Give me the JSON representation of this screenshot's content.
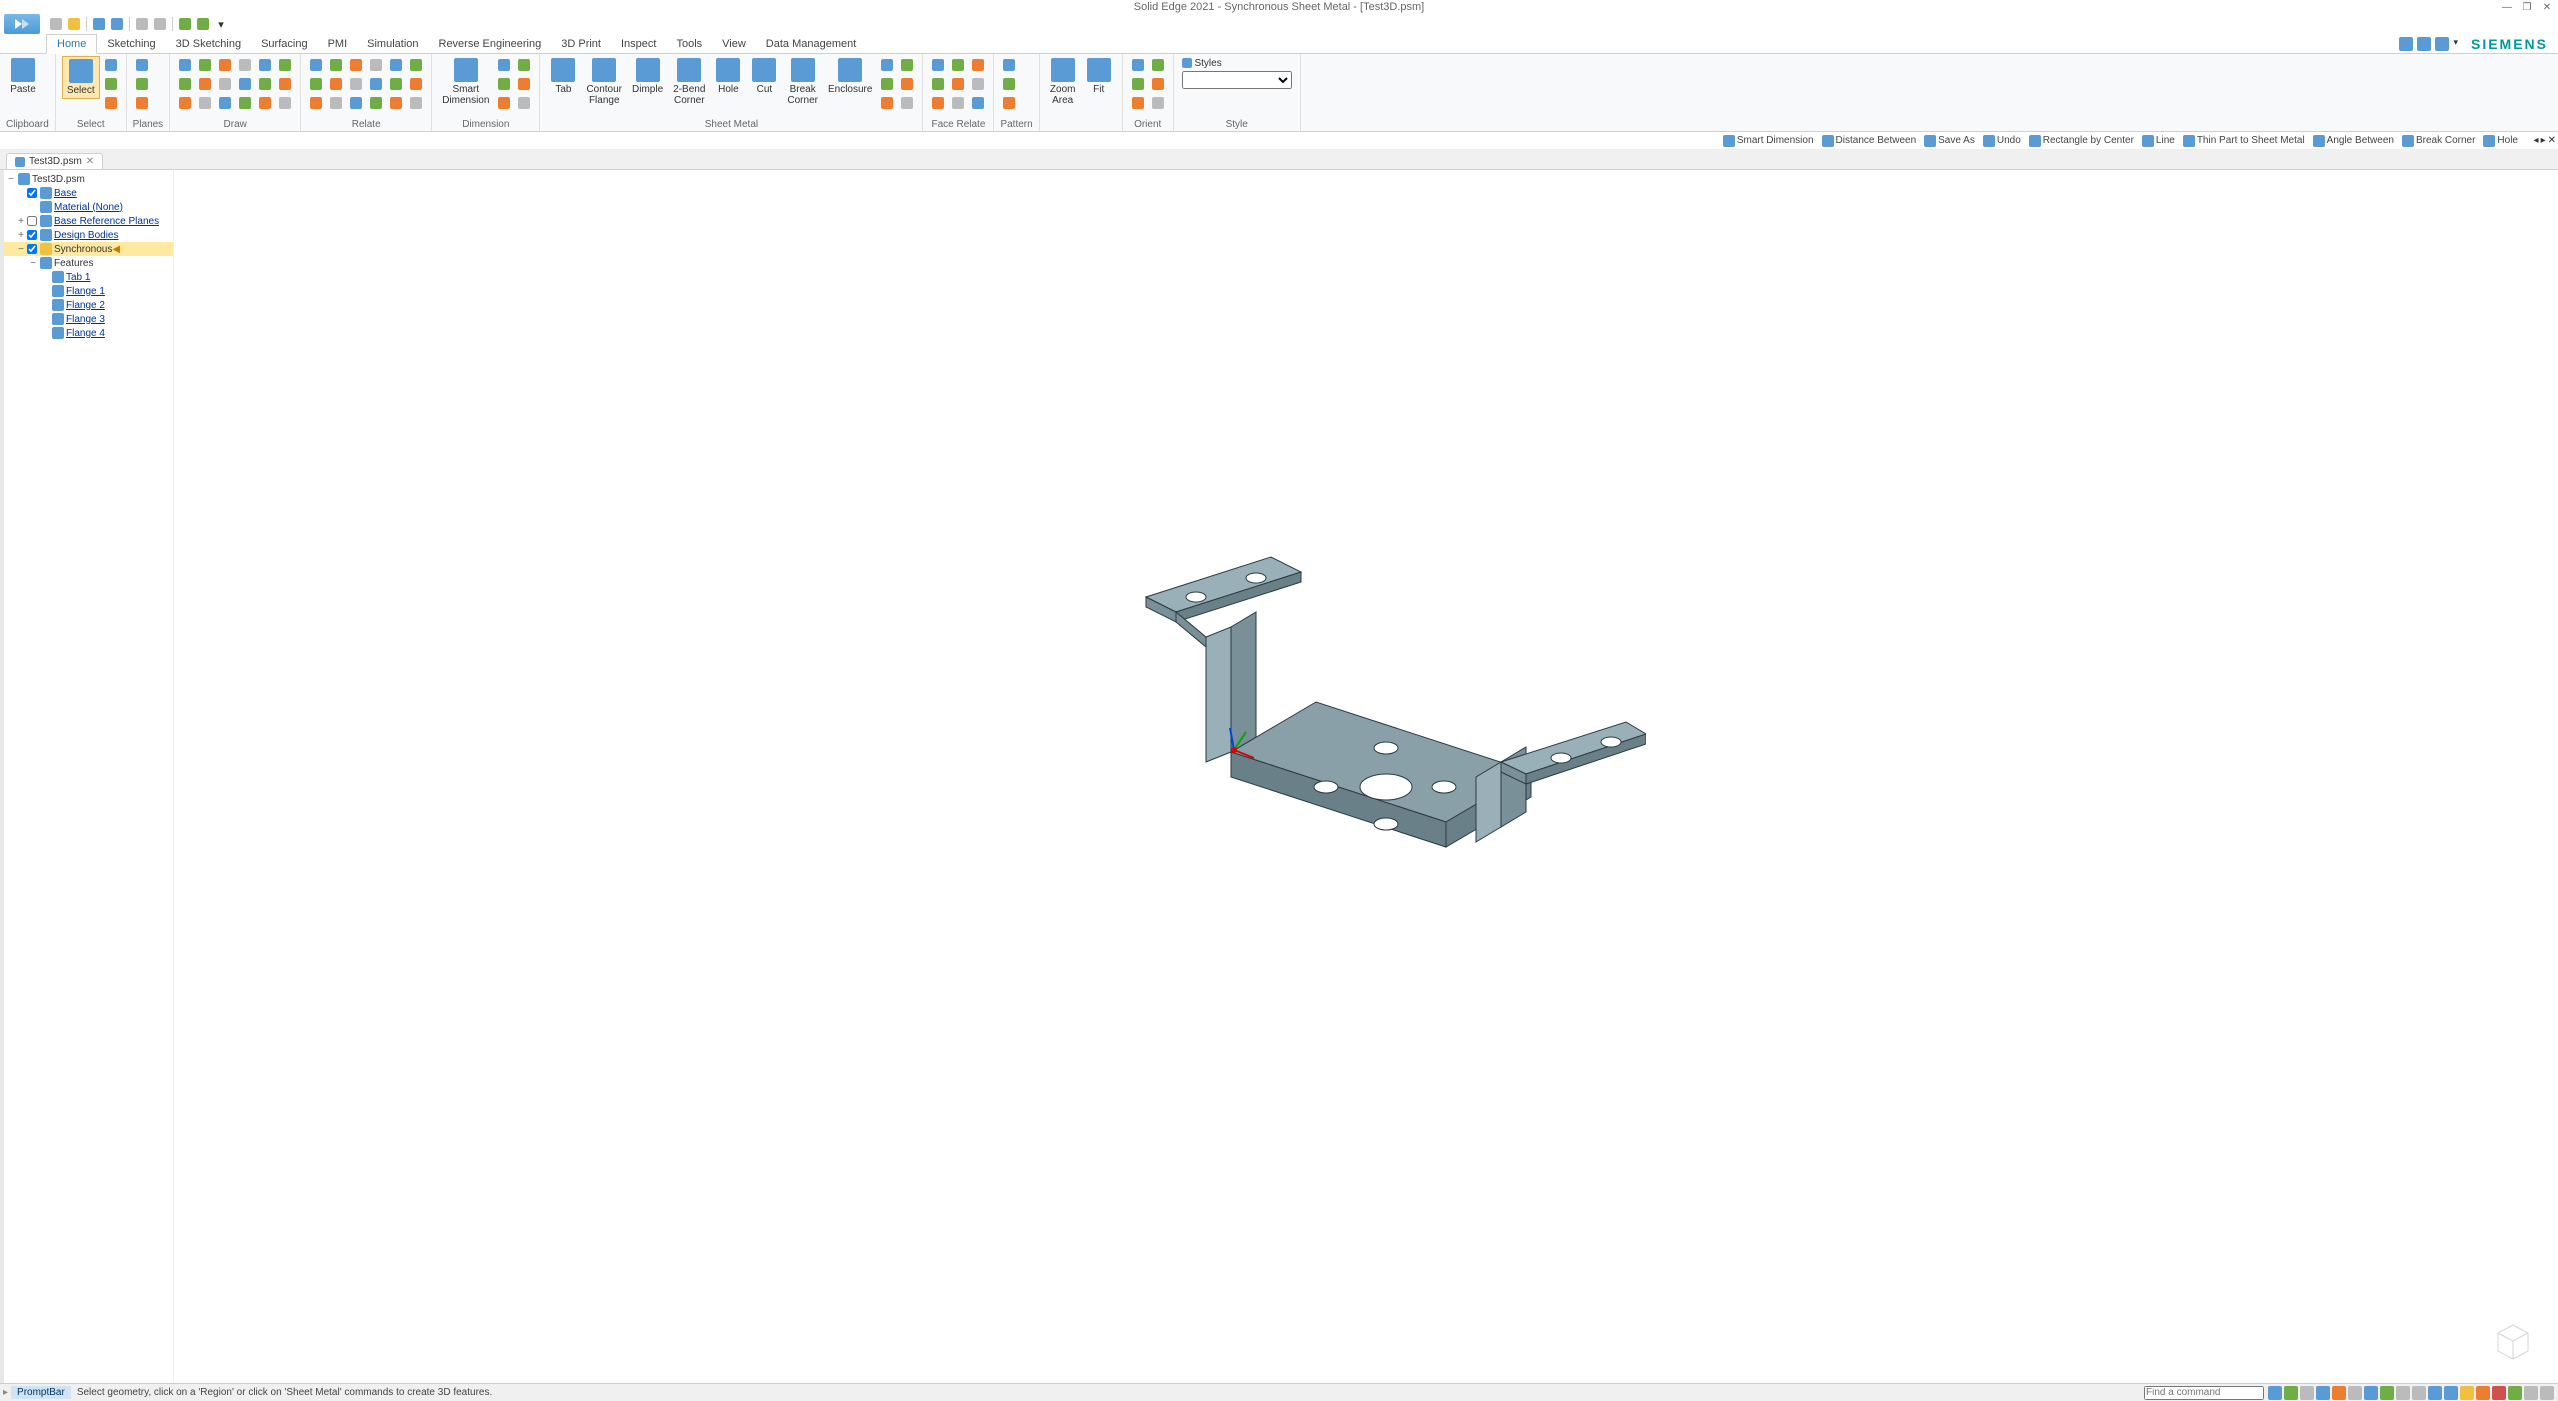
{
  "window": {
    "title": "Solid Edge 2021 - Synchronous Sheet Metal - [Test3D.psm]",
    "minimize": "—",
    "restore": "❐",
    "close": "✕"
  },
  "brand": "SIEMENS",
  "ribbon_tabs": [
    "Home",
    "Sketching",
    "3D Sketching",
    "Surfacing",
    "PMI",
    "Simulation",
    "Reverse Engineering",
    "3D Print",
    "Inspect",
    "Tools",
    "View",
    "Data Management"
  ],
  "active_tab": "Home",
  "qat": {
    "items": [
      "new",
      "open",
      "save",
      "saveall",
      "print",
      "undo",
      "redo",
      "dropdown"
    ]
  },
  "ribbon_groups": [
    {
      "label": "Clipboard",
      "buttons": [
        {
          "label": "Paste",
          "big": true
        }
      ]
    },
    {
      "label": "Select",
      "buttons": [
        {
          "label": "Select",
          "big": true,
          "active": true
        }
      ],
      "smalls": 3
    },
    {
      "label": "Planes",
      "buttons": [],
      "smalls": 3
    },
    {
      "label": "Draw",
      "buttons": [],
      "grid": true
    },
    {
      "label": "Relate",
      "buttons": [],
      "grid": true
    },
    {
      "label": "Dimension",
      "buttons": [
        {
          "label": "Smart\nDimension",
          "big": true
        }
      ],
      "smalls": 6
    },
    {
      "label": "Sheet Metal",
      "buttons": [
        {
          "label": "Tab"
        },
        {
          "label": "Contour\nFlange"
        },
        {
          "label": "Dimple"
        },
        {
          "label": "2-Bend\nCorner"
        },
        {
          "label": "Hole"
        },
        {
          "label": "Cut"
        },
        {
          "label": "Break\nCorner"
        },
        {
          "label": "Enclosure"
        }
      ],
      "smalls": 6
    },
    {
      "label": "Face Relate",
      "buttons": [],
      "smalls": 9
    },
    {
      "label": "Pattern",
      "buttons": [],
      "smalls": 3
    },
    {
      "label": "",
      "buttons": [
        {
          "label": "Zoom\nArea"
        },
        {
          "label": "Fit"
        }
      ]
    },
    {
      "label": "Orient",
      "buttons": [],
      "smalls": 6
    },
    {
      "label": "Style",
      "style": true,
      "styles_label": "Styles"
    }
  ],
  "sec_toolbar": [
    "Smart Dimension",
    "Distance Between",
    "Save As",
    "Undo",
    "Rectangle by Center",
    "Line",
    "Thin Part to Sheet Metal",
    "Angle Between",
    "Break Corner",
    "Hole"
  ],
  "doc_tab": {
    "name": "Test3D.psm"
  },
  "pathfinder": {
    "root": "Test3D.psm",
    "items": [
      {
        "level": 1,
        "chk": true,
        "text": "Base",
        "link": true
      },
      {
        "level": 2,
        "chk": false,
        "text": "Material (None)",
        "link": true,
        "exp": ""
      },
      {
        "level": 1,
        "chk": false,
        "text": "Base Reference Planes",
        "link": true,
        "exp": "+"
      },
      {
        "level": 1,
        "chk": true,
        "text": "Design Bodies",
        "link": true,
        "exp": "+"
      },
      {
        "level": 1,
        "chk": true,
        "text": "Synchronous",
        "link": false,
        "sel": true,
        "exp": "−"
      },
      {
        "level": 2,
        "chk": false,
        "text": "Features",
        "link": false,
        "exp": "−"
      },
      {
        "level": 3,
        "chk": false,
        "text": "Tab 1",
        "link": true
      },
      {
        "level": 3,
        "chk": false,
        "text": "Flange 1",
        "link": true
      },
      {
        "level": 3,
        "chk": false,
        "text": "Flange 2",
        "link": true
      },
      {
        "level": 3,
        "chk": false,
        "text": "Flange 3",
        "link": true
      },
      {
        "level": 3,
        "chk": false,
        "text": "Flange 4",
        "link": true
      }
    ]
  },
  "promptbar": {
    "label": "PromptBar",
    "msg": "Select geometry, click on a 'Region' or click on 'Sheet Metal' commands to create 3D features.",
    "cmd_placeholder": "Find a command"
  }
}
